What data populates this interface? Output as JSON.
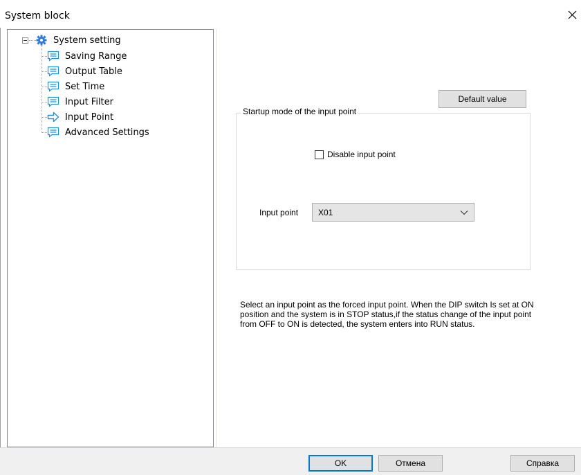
{
  "window": {
    "title": "System block"
  },
  "tree": {
    "root": {
      "label": "System setting",
      "icon": "gear-icon",
      "expanded": true
    },
    "items": [
      {
        "label": "Saving Range",
        "icon": "page-icon",
        "selected": false
      },
      {
        "label": "Output Table",
        "icon": "page-icon",
        "selected": false
      },
      {
        "label": "Set Time",
        "icon": "page-icon",
        "selected": false
      },
      {
        "label": "Input Filter",
        "icon": "page-icon",
        "selected": false
      },
      {
        "label": "Input Point",
        "icon": "arrow-right-icon",
        "selected": true
      },
      {
        "label": "Advanced Settings",
        "icon": "page-icon",
        "selected": false
      }
    ]
  },
  "panel": {
    "default_button": "Default value",
    "group_title": "Startup mode of the input point",
    "disable_checkbox": {
      "label": "Disable input point",
      "checked": false
    },
    "input_point": {
      "label": "Input point",
      "value": "X01"
    },
    "description": "Select an input point as the forced input point. When the DIP switch Is set at ON position and the system is in STOP status,if the status change of the input point from OFF to ON is detected, the system enters into RUN status."
  },
  "footer": {
    "ok": "OK",
    "cancel": "Отмена",
    "help": "Справка"
  },
  "colors": {
    "accent": "#0078d7",
    "gear": "#2e7bd6",
    "page_icon": "#1d8fe0",
    "button_face": "#e1e1e1",
    "footer_bg": "#f0f0f0"
  }
}
